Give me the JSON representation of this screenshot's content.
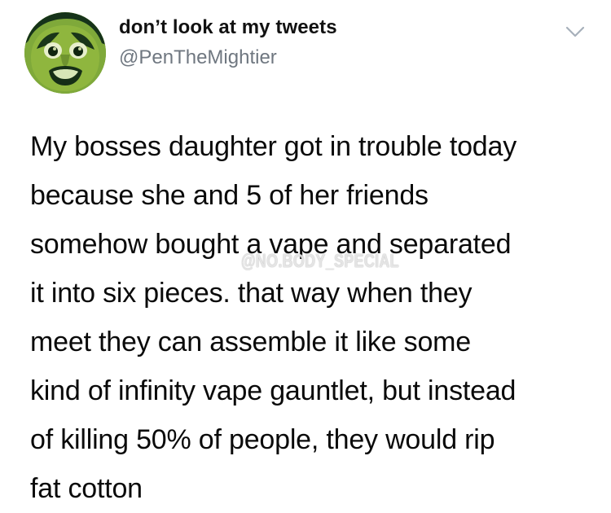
{
  "tweet": {
    "display_name": "don’t look at my tweets",
    "handle": "@PenTheMightier",
    "body_lines": [
      "My bosses daughter got in trouble today",
      "because she and 5 of her friends",
      "somehow bought a vape and separated",
      "it into six pieces. that way when they",
      "meet they can assemble it like some",
      "kind of infinity vape gauntlet, but instead",
      "of killing 50% of people, they would rip",
      "fat cotton"
    ],
    "watermark": "@NO.BODY_SPECIAL",
    "avatar_icon": "avatar-face-icon",
    "menu_icon": "chevron-down-icon"
  },
  "colors": {
    "background": "#ffffff",
    "name": "#111111",
    "handle": "#6f7780",
    "body": "#0a0a0a",
    "avatar_green": "#6f9a2d",
    "avatar_dark": "#123111"
  }
}
